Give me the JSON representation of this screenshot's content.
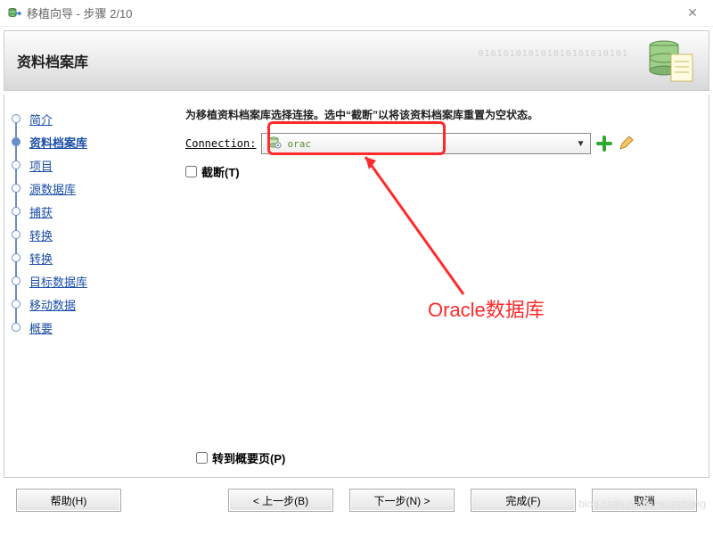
{
  "window": {
    "title": "移植向导 - 步骤 2/10",
    "close_glyph": "✕"
  },
  "header": {
    "title": "资料档案库",
    "binary_text": "010101010101010101010101"
  },
  "sidebar": {
    "items": [
      {
        "label": "简介"
      },
      {
        "label": "资料档案库"
      },
      {
        "label": "项目"
      },
      {
        "label": "源数据库"
      },
      {
        "label": "捕获"
      },
      {
        "label": "转换"
      },
      {
        "label": "转换"
      },
      {
        "label": "目标数据库"
      },
      {
        "label": "移动数据"
      },
      {
        "label": "概要"
      }
    ],
    "current_index": 1
  },
  "main": {
    "instruction": "为移植资料档案库选择连接。选中“截断”以将该资料档案库重置为空状态。",
    "connection_label": "Connection:",
    "connection_value": "orac",
    "truncate_label": "截断(T)",
    "goto_summary_label": "转到概要页(P)"
  },
  "buttons": {
    "help": "帮助(H)",
    "back": "< 上一步(B)",
    "next": "下一步(N) >",
    "finish": "完成(F)",
    "cancel": "取消"
  },
  "annotation": {
    "label": "Oracle数据库"
  },
  "watermark": "blog.csdn.net/junxuezheng"
}
